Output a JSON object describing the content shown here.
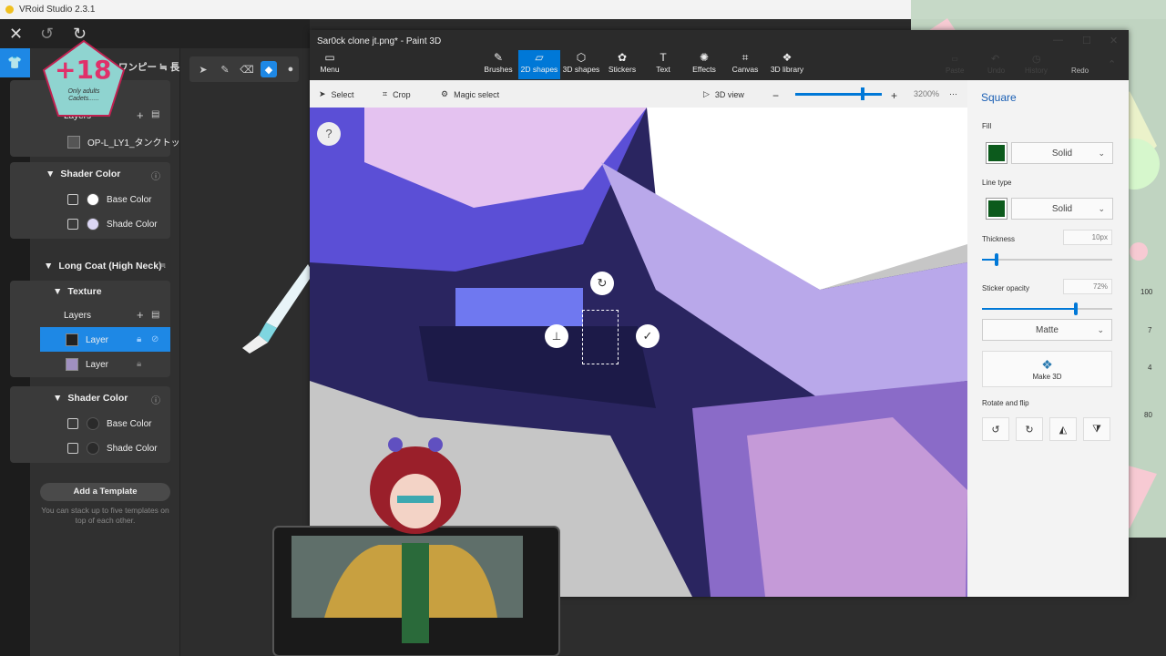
{
  "vroid": {
    "title": "VRoid Studio 2.3.1",
    "panel": {
      "header_partial": "ワンピー ≒ 長",
      "layers_label": "Layers",
      "layer_top": "OP-L_LY1_タンクトッ",
      "shader1_title": "Shader Color",
      "base_color": "Base Color",
      "shade_color": "Shade Color",
      "coat_title": "Long Coat (High Neck)",
      "texture_title": "Texture",
      "layers_label2": "Layers",
      "layer_selected": "Layer",
      "layer_second": "Layer",
      "shader2_title": "Shader Color",
      "base_color2": "Base Color",
      "shade_color2": "Shade Color",
      "add_template": "Add a Template",
      "template_note": "You can stack up to five templates on top of each other."
    },
    "badge": {
      "big": "+18",
      "small": "Only adults Cadets......"
    }
  },
  "paint3d": {
    "title": "Sar0ck clone jt.png* - Paint 3D",
    "menu": "Menu",
    "tabs": [
      {
        "label": "Brushes",
        "icon": "✎"
      },
      {
        "label": "2D shapes",
        "icon": "▱"
      },
      {
        "label": "3D shapes",
        "icon": "⬡"
      },
      {
        "label": "Stickers",
        "icon": "✿"
      },
      {
        "label": "Text",
        "icon": "T"
      },
      {
        "label": "Effects",
        "icon": "✺"
      },
      {
        "label": "Canvas",
        "icon": "⌗"
      },
      {
        "label": "3D library",
        "icon": "❖"
      }
    ],
    "right_tabs": [
      "Paste",
      "Undo",
      "History",
      "Redo"
    ],
    "sub": {
      "select": "Select",
      "crop": "Crop",
      "magic": "Magic select",
      "view3d": "3D view",
      "zoom": "3200%"
    },
    "panel": {
      "title": "Square",
      "fill_label": "Fill",
      "fill_value": "Solid",
      "line_label": "Line type",
      "line_value": "Solid",
      "thickness_label": "Thickness",
      "thickness_value": "10px",
      "thickness_fraction": 0.11,
      "opacity_label": "Sticker opacity",
      "opacity_value": "72%",
      "opacity_fraction": 0.72,
      "finish": "Matte",
      "make3d": "Make 3D",
      "rotate_label": "Rotate and flip"
    },
    "fill_color": "#0c5a1c",
    "accent_color": "#0078d7"
  },
  "right_edge": {
    "v100": "100",
    "v7": "7",
    "v4": "4",
    "v80": "80"
  }
}
